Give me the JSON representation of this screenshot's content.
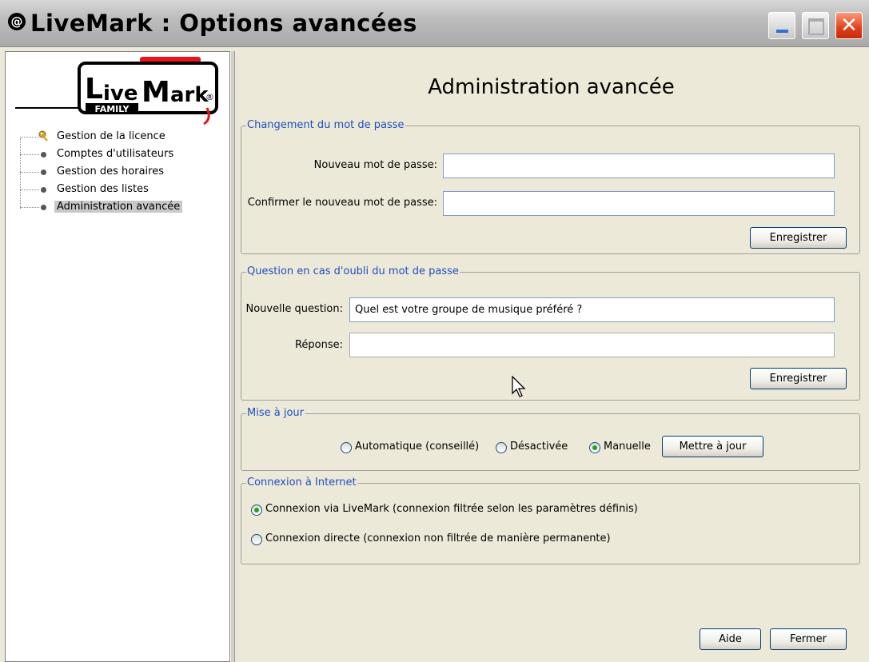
{
  "window": {
    "title": "LiveMark : Options avancées",
    "icon": "livemark-app-icon",
    "controls": {
      "minimize": "minimize-icon",
      "maximize": "maximize-icon",
      "close": "✕"
    }
  },
  "logo": {
    "name_live": "Live",
    "name_mark": "Mark",
    "family": "FAMILY",
    "registered": "®"
  },
  "tree": {
    "items": [
      {
        "label": "Gestion de la licence",
        "icon": "key-icon"
      },
      {
        "label": "Comptes d'utilisateurs",
        "icon": "bullet-icon"
      },
      {
        "label": "Gestion des horaires",
        "icon": "bullet-icon"
      },
      {
        "label": "Gestion des listes",
        "icon": "bullet-icon"
      },
      {
        "label": "Administration avancée",
        "icon": "bullet-icon",
        "selected": true
      }
    ]
  },
  "main": {
    "title": "Administration avancée",
    "password": {
      "legend": "Changement du mot de passe",
      "new_label": "Nouveau mot de passe:",
      "new_value": "",
      "confirm_label": "Confirmer le nouveau mot de passe:",
      "confirm_value": "",
      "save": "Enregistrer"
    },
    "question": {
      "legend": "Question en cas d'oubli du mot de passe",
      "question_label": "Nouvelle question:",
      "question_value": "Quel est votre groupe de musique préféré ?",
      "answer_label": "Réponse:",
      "answer_value": "",
      "save": "Enregistrer"
    },
    "update": {
      "legend": "Mise à jour",
      "options": [
        "Automatique (conseillé)",
        "Désactivée",
        "Manuelle"
      ],
      "selected": "Manuelle",
      "button": "Mettre à jour"
    },
    "internet": {
      "legend": "Connexion à Internet",
      "options": [
        "Connexion via LiveMark (connexion filtrée selon les paramètres définis)",
        "Connexion directe (connexion non filtrée de manière permanente)"
      ],
      "selected": "Connexion via LiveMark (connexion filtrée selon les paramètres définis)"
    },
    "help": "Aide",
    "close": "Fermer"
  },
  "colors": {
    "legend": "#1f4fbf",
    "selection": "#c8c8c8",
    "radio_on": "#21a121",
    "logo_red": "#e8141e"
  }
}
